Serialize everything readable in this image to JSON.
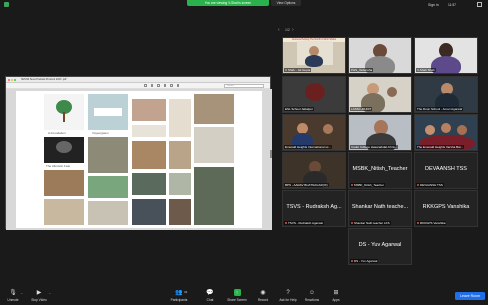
{
  "topbar": {
    "sharing_text": "You are viewing V-Shah's screen",
    "view_options": "View Options",
    "sign_in": "Sign in",
    "time": "11:57",
    "page": "1/2"
  },
  "shared_window": {
    "title": "SMI-Nil Seva Podcast Protocol 2023 .pdf",
    "search_placeholder": "Search",
    "slide_labels": {
      "foundation": "A Foundation",
      "altruistic": "The Altruistic Feat",
      "voyage": "Voyeurgasm"
    }
  },
  "tiles": [
    {
      "id": "t1",
      "name": "V Shah - Jai Gupta",
      "kind": "video"
    },
    {
      "id": "t2",
      "name": "PHS_Vedansha",
      "kind": "video"
    },
    {
      "id": "t3",
      "name": "V-Shah Shah",
      "kind": "video"
    },
    {
      "id": "t4",
      "name": "ESL School Jabalpur",
      "kind": "video"
    },
    {
      "id": "t5",
      "name": "LASSC-MUDIT",
      "kind": "video"
    },
    {
      "id": "t6",
      "name": "The Doon School - Aman Agarwal",
      "kind": "video"
    },
    {
      "id": "t7",
      "name": "Emerald Heights International sc...",
      "kind": "video"
    },
    {
      "id": "t8",
      "name": "Cadet College Hasanabdal-Chris...",
      "kind": "video"
    },
    {
      "id": "t9",
      "name": "The Emerald Heights Varsha Bal...",
      "kind": "video"
    },
    {
      "id": "t10",
      "name": "BPS - AARAV BHATNAGAR(IX)",
      "big": "",
      "kind": "video"
    },
    {
      "id": "t11",
      "name": "MSBK_Nitish_Teacher",
      "big": "MSBK_Nitish_Teacher",
      "kind": "name"
    },
    {
      "id": "t12",
      "name": "DEVAANSH TSS",
      "big": "DEVAANSH TSS",
      "kind": "name"
    },
    {
      "id": "t13",
      "name": "TSVS - Rudraksh Agarwal",
      "big": "TSVS - Rudraksh Ag...",
      "kind": "name"
    },
    {
      "id": "t14",
      "name": "Shankar Nath teacher LKS",
      "big": "Shankar Nath teache...",
      "kind": "name"
    },
    {
      "id": "t15",
      "name": "RKKGPS Vanshika",
      "big": "RKKGPS Vanshika",
      "kind": "name"
    },
    {
      "id": "t16",
      "name": "DS - Yuv Agarwal",
      "big": "DS - Yuv Agarwal",
      "kind": "name"
    }
  ],
  "toolbar": {
    "unmute": "Unmute",
    "stop_video": "Stop Video",
    "participants": "Participants",
    "participants_count": "34",
    "chat": "Chat",
    "share_screen": "Share Screen",
    "record": "Record",
    "ask_for_help": "Ask for Help",
    "reactions": "Reactions",
    "apps": "Apps",
    "leave_room": "Leave Room"
  },
  "colors": {
    "accent_green": "#2bb24c",
    "leave_blue": "#1f6feb",
    "background": "#1a1a1a"
  }
}
